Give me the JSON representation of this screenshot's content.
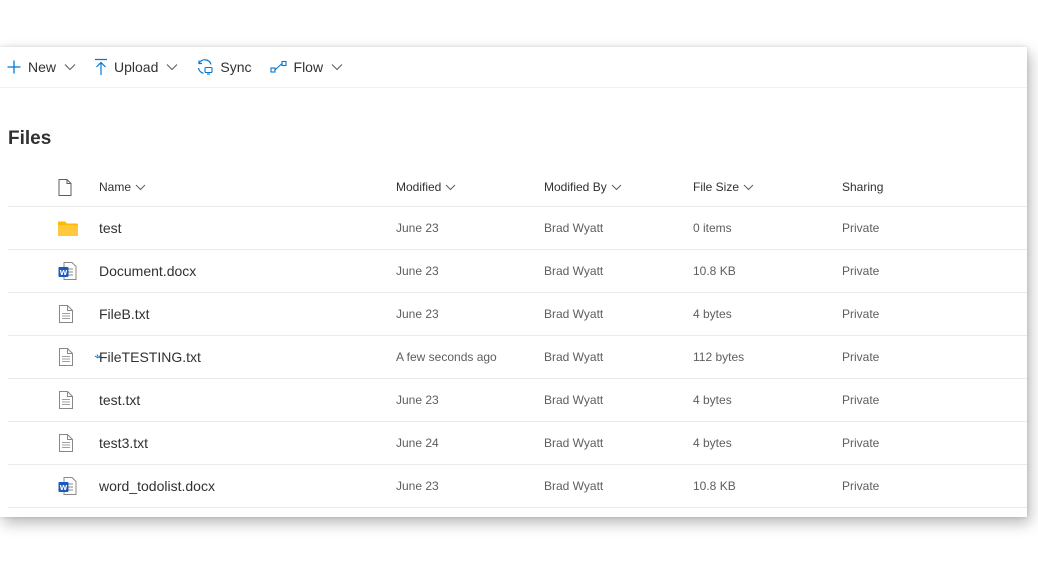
{
  "toolbar": {
    "new_label": "New",
    "upload_label": "Upload",
    "sync_label": "Sync",
    "flow_label": "Flow"
  },
  "page_title": "Files",
  "columns": {
    "name": "Name",
    "modified": "Modified",
    "modified_by": "Modified By",
    "file_size": "File Size",
    "sharing": "Sharing"
  },
  "files": [
    {
      "icon": "folder-icon",
      "name": "test",
      "modified": "June 23",
      "modified_by": "Brad Wyatt",
      "file_size": "0 items",
      "sharing": "Private"
    },
    {
      "icon": "word-doc-icon",
      "name": "Document.docx",
      "modified": "June 23",
      "modified_by": "Brad Wyatt",
      "file_size": "10.8 KB",
      "sharing": "Private"
    },
    {
      "icon": "text-file-icon",
      "name": "FileB.txt",
      "modified": "June 23",
      "modified_by": "Brad Wyatt",
      "file_size": "4 bytes",
      "sharing": "Private"
    },
    {
      "icon": "text-file-icon",
      "name": "FileTESTING.txt",
      "modified": "A few seconds ago",
      "modified_by": "Brad Wyatt",
      "file_size": "112 bytes",
      "sharing": "Private",
      "is_new": true
    },
    {
      "icon": "text-file-icon",
      "name": "test.txt",
      "modified": "June 23",
      "modified_by": "Brad Wyatt",
      "file_size": "4 bytes",
      "sharing": "Private"
    },
    {
      "icon": "text-file-icon",
      "name": "test3.txt",
      "modified": "June 24",
      "modified_by": "Brad Wyatt",
      "file_size": "4 bytes",
      "sharing": "Private"
    },
    {
      "icon": "word-doc-icon",
      "name": "word_todolist.docx",
      "modified": "June 23",
      "modified_by": "Brad Wyatt",
      "file_size": "10.8 KB",
      "sharing": "Private"
    }
  ],
  "colors": {
    "accent": "#0078d4",
    "folder": "#ffb900",
    "word": "#185abd",
    "text": "#323130",
    "secondary_text": "#605e5c",
    "divider": "#edebe9"
  }
}
